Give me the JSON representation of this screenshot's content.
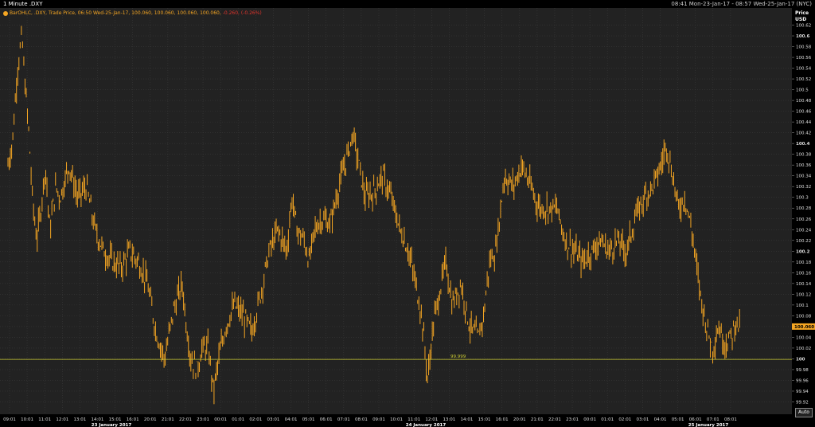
{
  "header": {
    "title": "1 Minute .DXY",
    "range": "08:41 Mon-23-Jan-17 - 08:57 Wed-25-Jan-17 (NYC)"
  },
  "legend": {
    "series_desc": "BarOHLC, .DXY, Trade Price, 06:50 Wed-25-Jan-17, 100.060, 100.060, 100.060, 100.060,",
    "change": "-0.260, (-0.26%)"
  },
  "price_axis": {
    "title_line1": "Price",
    "title_line2": "USD"
  },
  "auto_label": "Auto",
  "colors": {
    "background": "#222222",
    "grid": "#3a3a3a",
    "series": "#f5a623",
    "reference": "#cccc33",
    "last_badge": "#f5a623"
  },
  "chart_data": {
    "type": "bar",
    "subtype": "OHLC price bars",
    "title": "1 Minute .DXY",
    "ylabel": "Price USD",
    "ylim": [
      99.9,
      100.64
    ],
    "y_ticks": [
      "100.62",
      "100.6",
      "100.58",
      "100.56",
      "100.54",
      "100.52",
      "100.5",
      "100.48",
      "100.46",
      "100.44",
      "100.42",
      "100.4",
      "100.38",
      "100.36",
      "100.34",
      "100.32",
      "100.3",
      "100.28",
      "100.26",
      "100.24",
      "100.22",
      "100.2",
      "100.18",
      "100.16",
      "100.14",
      "100.12",
      "100.1",
      "100.08",
      "100.06",
      "100.04",
      "100.02",
      "100",
      "99.98",
      "99.96",
      "99.94",
      "99.92"
    ],
    "y_ticks_bold": [
      "100.6",
      "100.4",
      "100.2",
      "100"
    ],
    "x_ticks": [
      "09:01",
      "10:01",
      "11:01",
      "12:01",
      "13:01",
      "14:01",
      "15:01",
      "16:01",
      "20:01",
      "21:01",
      "22:01",
      "23:01",
      "00:01",
      "01:01",
      "02:01",
      "03:01",
      "04:01",
      "05:01",
      "06:01",
      "07:01",
      "08:01",
      "09:01",
      "10:01",
      "11:01",
      "12:01",
      "13:01",
      "14:01",
      "15:01",
      "16:01",
      "20:01",
      "21:01",
      "22:01",
      "23:01",
      "00:01",
      "01:01",
      "02:01",
      "03:01",
      "04:01",
      "05:01",
      "06:01",
      "07:01",
      "08:01"
    ],
    "date_labels": [
      "23 January 2017",
      "24 January 2017",
      "25 January 2017"
    ],
    "reference_line": {
      "value": 99.999,
      "label": "99.999"
    },
    "last_price": {
      "value": 100.06,
      "label": "100.060"
    },
    "price_path": [
      {
        "t": 0,
        "v": 100.36
      },
      {
        "t": 0.5,
        "v": 100.4
      },
      {
        "t": 1.1,
        "v": 100.54
      },
      {
        "t": 1.6,
        "v": 100.6
      },
      {
        "t": 2.0,
        "v": 100.5
      },
      {
        "t": 2.4,
        "v": 100.42
      },
      {
        "t": 2.8,
        "v": 100.3
      },
      {
        "t": 3.3,
        "v": 100.22
      },
      {
        "t": 3.8,
        "v": 100.28
      },
      {
        "t": 4.3,
        "v": 100.36
      },
      {
        "t": 4.8,
        "v": 100.24
      },
      {
        "t": 5.5,
        "v": 100.32
      },
      {
        "t": 6.0,
        "v": 100.3
      },
      {
        "t": 7.0,
        "v": 100.36
      },
      {
        "t": 8.0,
        "v": 100.3
      },
      {
        "t": 9.0,
        "v": 100.32
      },
      {
        "t": 10.0,
        "v": 100.24
      },
      {
        "t": 11.0,
        "v": 100.2
      },
      {
        "t": 12.0,
        "v": 100.18
      },
      {
        "t": 13.0,
        "v": 100.17
      },
      {
        "t": 14.0,
        "v": 100.2
      },
      {
        "t": 15.0,
        "v": 100.18
      },
      {
        "t": 16.0,
        "v": 100.14
      },
      {
        "t": 17.0,
        "v": 100.05
      },
      {
        "t": 18.0,
        "v": 100.0
      },
      {
        "t": 19.0,
        "v": 100.09
      },
      {
        "t": 20.0,
        "v": 100.14
      },
      {
        "t": 20.5,
        "v": 100.06
      },
      {
        "t": 21.0,
        "v": 100.0
      },
      {
        "t": 21.7,
        "v": 99.98
      },
      {
        "t": 22.3,
        "v": 100.02
      },
      {
        "t": 23.0,
        "v": 100.02
      },
      {
        "t": 23.6,
        "v": 99.94
      },
      {
        "t": 24.2,
        "v": 100.0
      },
      {
        "t": 25.0,
        "v": 100.06
      },
      {
        "t": 26.0,
        "v": 100.1
      },
      {
        "t": 27.0,
        "v": 100.08
      },
      {
        "t": 28.0,
        "v": 100.05
      },
      {
        "t": 29.0,
        "v": 100.12
      },
      {
        "t": 30.0,
        "v": 100.2
      },
      {
        "t": 31.0,
        "v": 100.24
      },
      {
        "t": 32.0,
        "v": 100.2
      },
      {
        "t": 32.6,
        "v": 100.3
      },
      {
        "t": 33.2,
        "v": 100.24
      },
      {
        "t": 34.0,
        "v": 100.22
      },
      {
        "t": 34.6,
        "v": 100.18
      },
      {
        "t": 35.2,
        "v": 100.24
      },
      {
        "t": 36.0,
        "v": 100.26
      },
      {
        "t": 37.0,
        "v": 100.25
      },
      {
        "t": 38.0,
        "v": 100.32
      },
      {
        "t": 39.0,
        "v": 100.38
      },
      {
        "t": 39.6,
        "v": 100.42
      },
      {
        "t": 40.3,
        "v": 100.36
      },
      {
        "t": 41.0,
        "v": 100.3
      },
      {
        "t": 42.0,
        "v": 100.31
      },
      {
        "t": 43.0,
        "v": 100.34
      },
      {
        "t": 44.0,
        "v": 100.3
      },
      {
        "t": 45.0,
        "v": 100.24
      },
      {
        "t": 46.0,
        "v": 100.2
      },
      {
        "t": 46.8,
        "v": 100.14
      },
      {
        "t": 47.5,
        "v": 100.08
      },
      {
        "t": 48.2,
        "v": 99.96
      },
      {
        "t": 48.8,
        "v": 100.06
      },
      {
        "t": 49.5,
        "v": 100.12
      },
      {
        "t": 50.3,
        "v": 100.18
      },
      {
        "t": 51.0,
        "v": 100.1
      },
      {
        "t": 52.0,
        "v": 100.14
      },
      {
        "t": 53.0,
        "v": 100.06
      },
      {
        "t": 54.0,
        "v": 100.04
      },
      {
        "t": 54.6,
        "v": 100.08
      },
      {
        "t": 55.3,
        "v": 100.18
      },
      {
        "t": 56.0,
        "v": 100.2
      },
      {
        "t": 57.0,
        "v": 100.34
      },
      {
        "t": 58.0,
        "v": 100.32
      },
      {
        "t": 59.0,
        "v": 100.36
      },
      {
        "t": 60.0,
        "v": 100.32
      },
      {
        "t": 61.0,
        "v": 100.28
      },
      {
        "t": 62.0,
        "v": 100.28
      },
      {
        "t": 63.0,
        "v": 100.28
      },
      {
        "t": 64.0,
        "v": 100.22
      },
      {
        "t": 65.0,
        "v": 100.2
      },
      {
        "t": 66.0,
        "v": 100.18
      },
      {
        "t": 67.0,
        "v": 100.2
      },
      {
        "t": 68.0,
        "v": 100.22
      },
      {
        "t": 69.0,
        "v": 100.2
      },
      {
        "t": 70.0,
        "v": 100.22
      },
      {
        "t": 71.0,
        "v": 100.2
      },
      {
        "t": 72.0,
        "v": 100.26
      },
      {
        "t": 73.0,
        "v": 100.3
      },
      {
        "t": 74.0,
        "v": 100.32
      },
      {
        "t": 75.0,
        "v": 100.36
      },
      {
        "t": 75.6,
        "v": 100.4
      },
      {
        "t": 76.3,
        "v": 100.34
      },
      {
        "t": 77.0,
        "v": 100.28
      },
      {
        "t": 77.7,
        "v": 100.3
      },
      {
        "t": 78.5,
        "v": 100.24
      },
      {
        "t": 79.0,
        "v": 100.18
      },
      {
        "t": 79.5,
        "v": 100.12
      },
      {
        "t": 80.2,
        "v": 100.06
      },
      {
        "t": 80.9,
        "v": 100.02
      },
      {
        "t": 81.6,
        "v": 100.06
      },
      {
        "t": 82.2,
        "v": 100.03
      },
      {
        "t": 83.0,
        "v": 100.04
      },
      {
        "t": 83.6,
        "v": 100.07
      },
      {
        "t": 84.0,
        "v": 100.06
      }
    ]
  }
}
